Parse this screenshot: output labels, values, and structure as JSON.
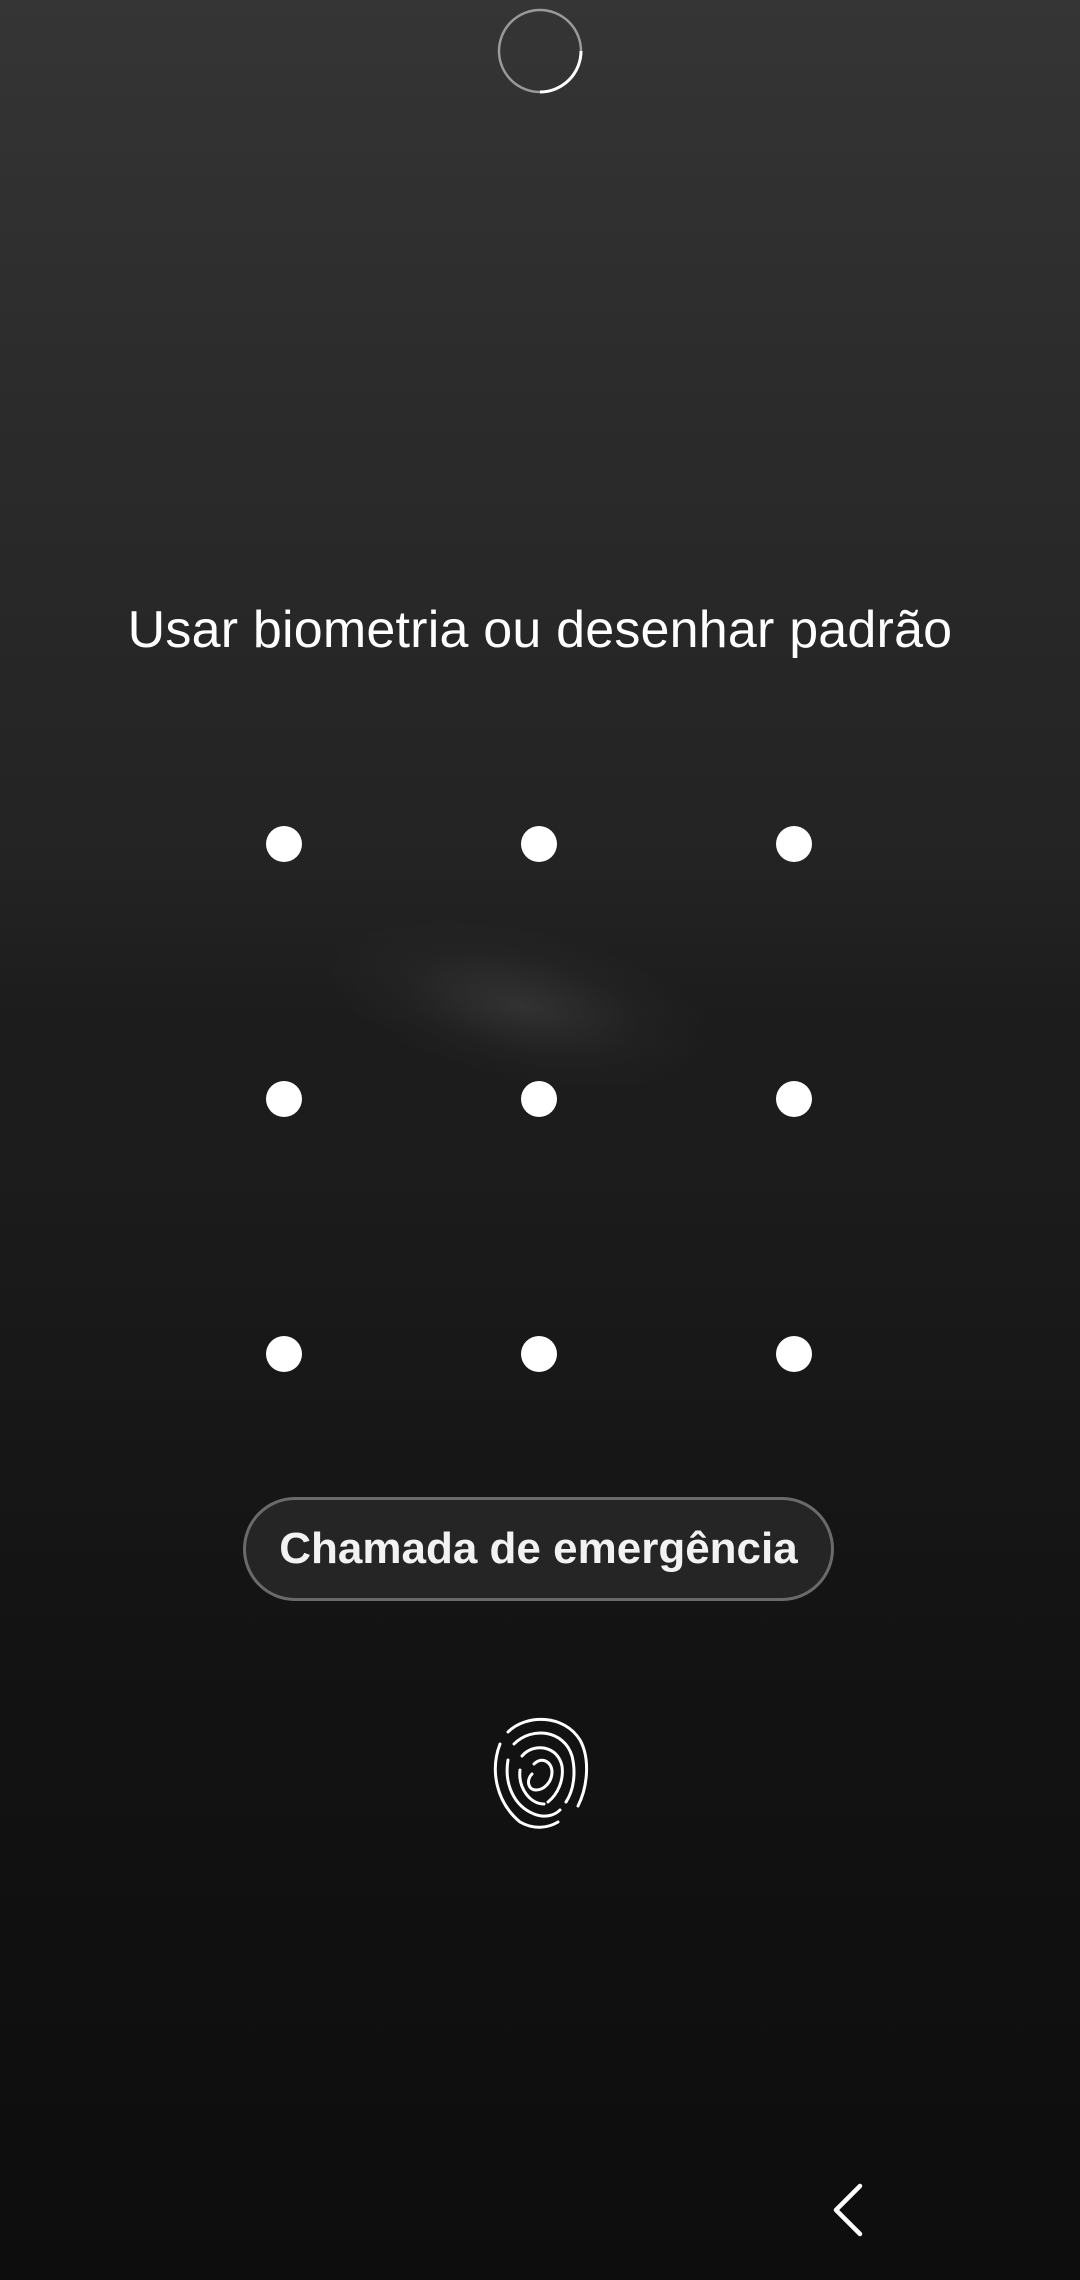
{
  "lock_screen": {
    "instruction_text": "Usar biometria ou desenhar padrão",
    "emergency_call_label": "Chamada de emergência",
    "pattern_dots": [
      {
        "row": 1,
        "col": 1
      },
      {
        "row": 1,
        "col": 2
      },
      {
        "row": 1,
        "col": 3
      },
      {
        "row": 2,
        "col": 1
      },
      {
        "row": 2,
        "col": 2
      },
      {
        "row": 2,
        "col": 3
      },
      {
        "row": 3,
        "col": 1
      },
      {
        "row": 3,
        "col": 2
      },
      {
        "row": 3,
        "col": 3
      }
    ]
  },
  "icons": {
    "top": "lock-status-ring-icon",
    "biometric": "fingerprint-icon",
    "navigation": "back-chevron-icon"
  },
  "colors": {
    "background_top": "#353535",
    "background_bottom": "#0d0d0d",
    "foreground": "#ffffff",
    "button_border": "#6a6a6a"
  }
}
